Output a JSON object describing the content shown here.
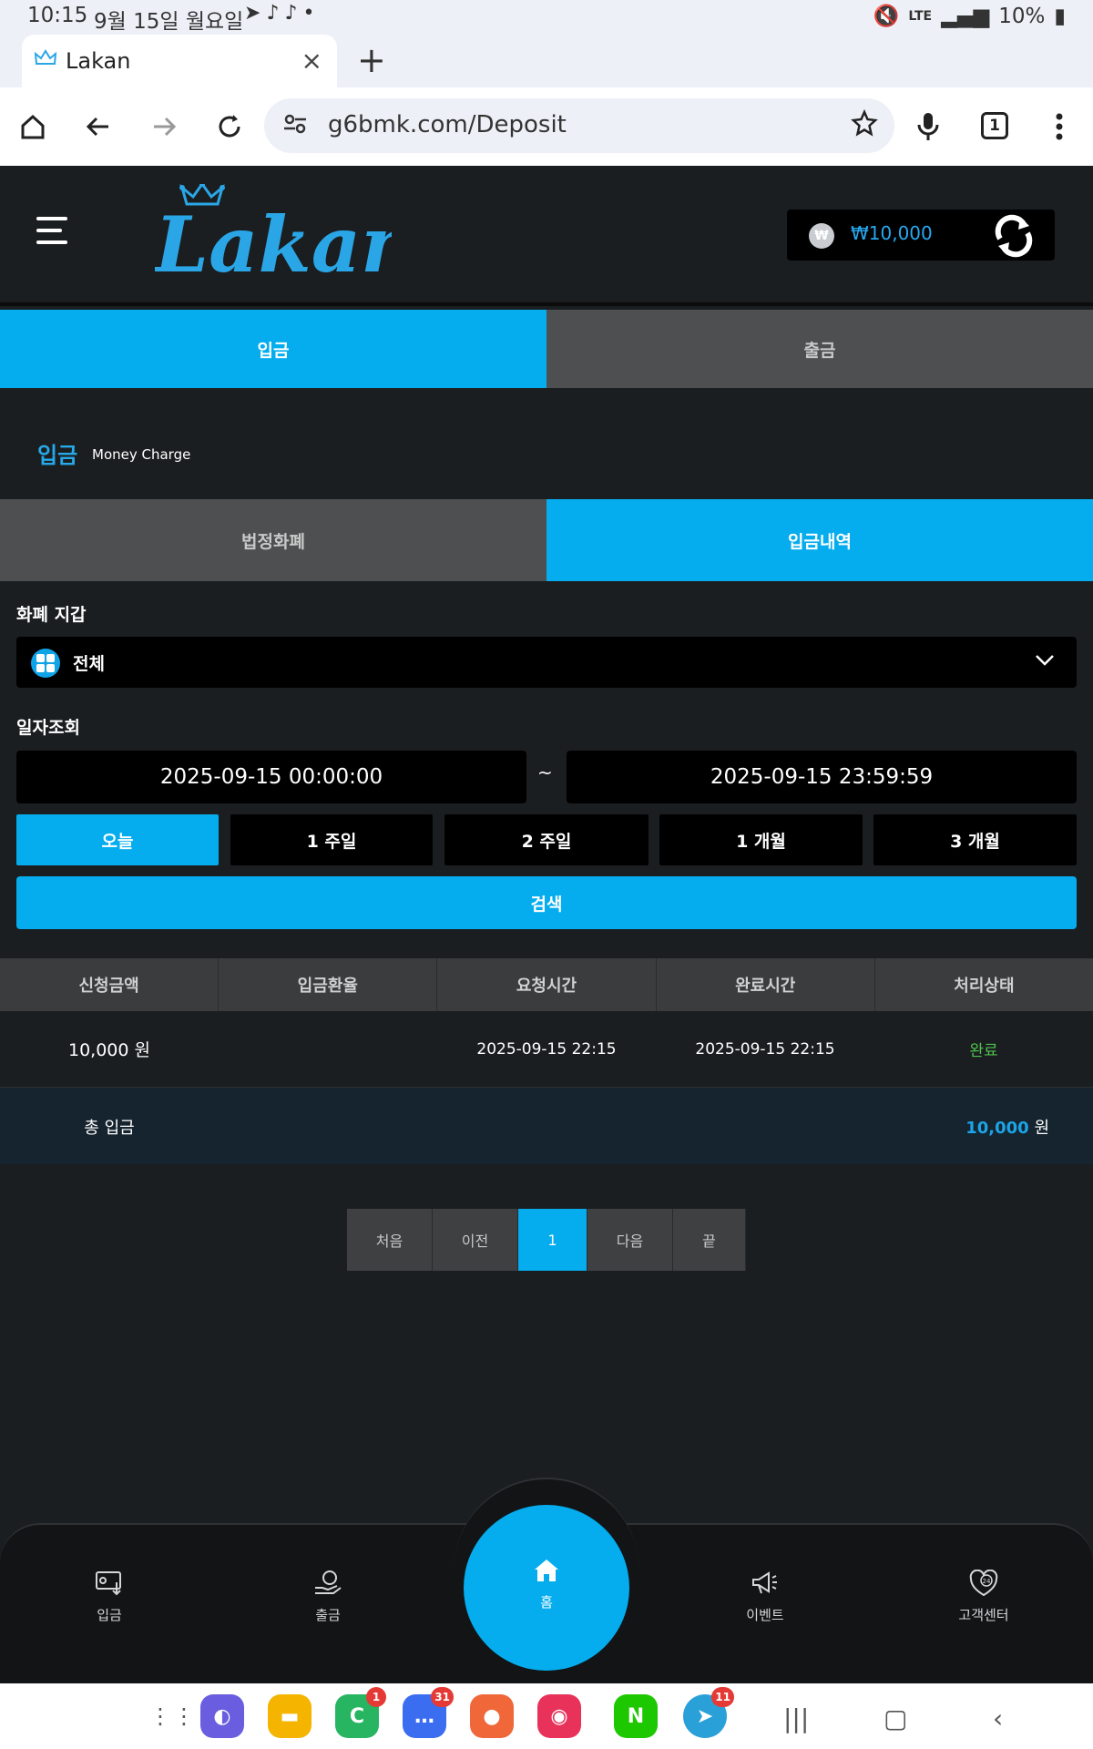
{
  "status_bar": {
    "time": "10:15",
    "date": "9월 15일 월요일",
    "battery": "10%",
    "network": "LTE"
  },
  "browser": {
    "tab_title": "Lakan",
    "url": "g6bmk.com/Deposit",
    "tab_count": "1"
  },
  "header": {
    "logo_text": "Lakan",
    "balance": "₩10,000",
    "currency_symbol": "₩"
  },
  "main_tabs": [
    {
      "label": "입금",
      "active": true
    },
    {
      "label": "출금",
      "active": false
    }
  ],
  "section": {
    "title": "입금",
    "subtitle": "Money Charge"
  },
  "sub_tabs": [
    {
      "label": "법정화폐",
      "active": false
    },
    {
      "label": "입금내역",
      "active": true
    }
  ],
  "filters": {
    "wallet_label": "화폐 지갑",
    "wallet_value": "전체",
    "date_label": "일자조회",
    "date_from": "2025-09-15 00:00:00",
    "date_sep": "~",
    "date_to": "2025-09-15 23:59:59",
    "periods": [
      "오늘",
      "1 주일",
      "2 주일",
      "1 개월",
      "3 개월"
    ],
    "search_label": "검색"
  },
  "table": {
    "columns": [
      "신청금액",
      "입금환율",
      "요청시간",
      "완료시간",
      "처리상태"
    ],
    "rows": [
      {
        "amount": "10,000 원",
        "rate": "",
        "requested": "2025-09-15 22:15",
        "completed": "2025-09-15 22:15",
        "status": "완료"
      }
    ],
    "total_label": "총 입금",
    "total_value": "10,000",
    "total_unit": "원"
  },
  "pagination": {
    "first": "처음",
    "prev": "이전",
    "current": "1",
    "next": "다음",
    "last": "끝"
  },
  "bottom_nav": {
    "deposit": "입금",
    "withdraw": "출금",
    "home": "홈",
    "event": "이벤트",
    "support": "고객센터"
  },
  "dock_badges": {
    "phone": "1",
    "messages": "31",
    "telegram": "11"
  },
  "colors": {
    "accent": "#05adee",
    "background": "#1b1e20",
    "success": "#4ec34e"
  }
}
